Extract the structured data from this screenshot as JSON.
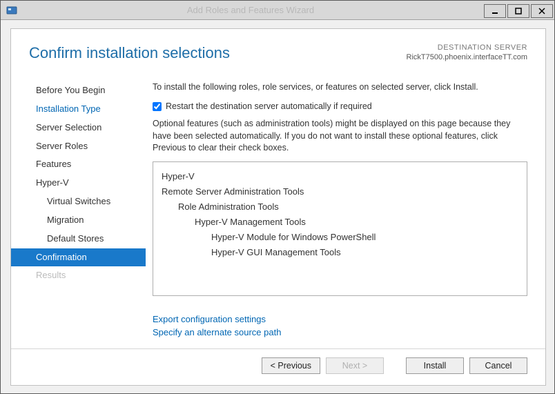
{
  "window": {
    "title": "Add Roles and Features Wizard"
  },
  "header": {
    "title": "Confirm installation selections",
    "destination_label": "DESTINATION SERVER",
    "destination_server": "RickT7500.phoenix.interfaceTT.com"
  },
  "nav": {
    "before": "Before You Begin",
    "install_type": "Installation Type",
    "server_sel": "Server Selection",
    "server_roles": "Server Roles",
    "features": "Features",
    "hyperv": "Hyper-V",
    "vswitch": "Virtual Switches",
    "migration": "Migration",
    "default_stores": "Default Stores",
    "confirmation": "Confirmation",
    "results": "Results"
  },
  "content": {
    "instruction": "To install the following roles, role services, or features on selected server, click Install.",
    "restart_label": "Restart the destination server automatically if required",
    "restart_checked": true,
    "note": "Optional features (such as administration tools) might be displayed on this page because they have been selected automatically. If you do not want to install these optional features, click Previous to clear their check boxes.",
    "features": {
      "l0a": "Hyper-V",
      "l0b": "Remote Server Administration Tools",
      "l1a": "Role Administration Tools",
      "l2a": "Hyper-V Management Tools",
      "l3a": "Hyper-V Module for Windows PowerShell",
      "l3b": "Hyper-V GUI Management Tools"
    },
    "link_export": "Export configuration settings",
    "link_source": "Specify an alternate source path"
  },
  "buttons": {
    "previous": "< Previous",
    "next": "Next >",
    "install": "Install",
    "cancel": "Cancel"
  }
}
